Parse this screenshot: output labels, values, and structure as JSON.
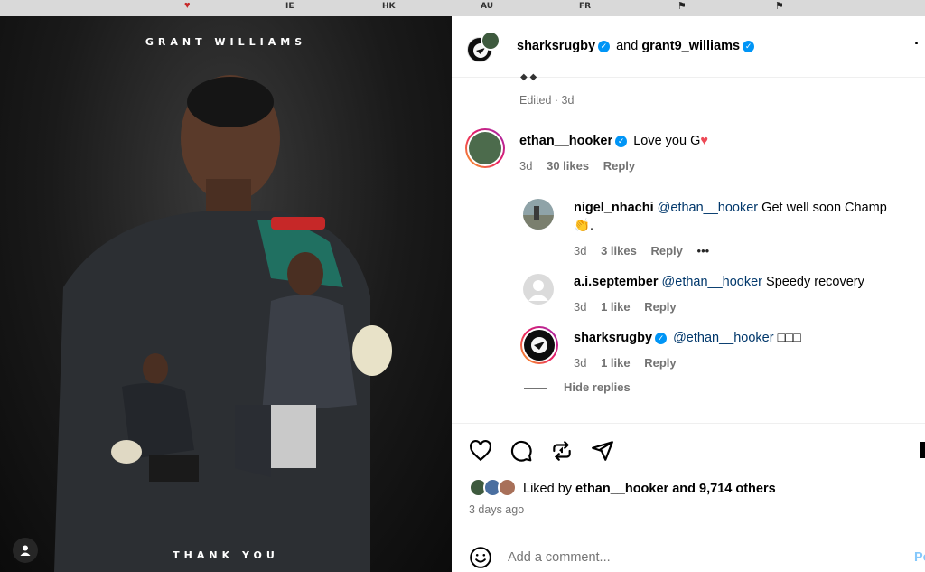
{
  "topbar": {
    "flags": [
      "IE",
      "HK",
      "AU",
      "FR"
    ]
  },
  "photo": {
    "title": "GRANT WILLIAMS",
    "caption": "THANK YOU"
  },
  "header": {
    "user1": "sharksrugby",
    "connector": "and",
    "user2": "grant9_williams"
  },
  "post": {
    "edited_meta": "Edited · 3d"
  },
  "comments": [
    {
      "user": "ethan__hooker",
      "text": "Love you G",
      "emoji": "❤️",
      "time": "3d",
      "likes": "30 likes",
      "reply": "Reply"
    }
  ],
  "replies": [
    {
      "user": "nigel_nhachi",
      "mention": "@ethan__hooker",
      "text": "Get well soon Champ",
      "line2": "👏.",
      "time": "3d",
      "likes": "3 likes",
      "reply": "Reply",
      "more": "•••"
    },
    {
      "user": "a.i.september",
      "mention": "@ethan__hooker",
      "text": "Speedy recovery",
      "time": "3d",
      "likes": "1 like",
      "reply": "Reply"
    },
    {
      "user": "sharksrugby",
      "mention": "@ethan__hooker",
      "text": "□□□",
      "time": "3d",
      "likes": "1 like",
      "reply": "Reply"
    }
  ],
  "hide_replies": "Hide replies",
  "likes": {
    "prefix": "Liked by",
    "user": "ethan__hooker",
    "suffix": "and 9,714 others",
    "time": "3 days ago"
  },
  "comment_box": {
    "placeholder": "Add a comment...",
    "post_label": "Po"
  },
  "colors": {
    "verified": "#0095f6",
    "link": "#00376b",
    "heart": "#ed4956"
  }
}
